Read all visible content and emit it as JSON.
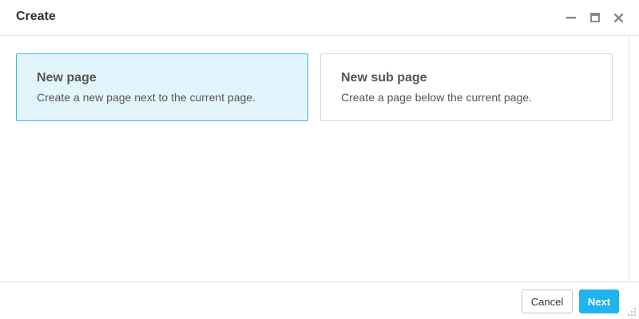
{
  "dialog": {
    "title": "Create",
    "window_controls": {
      "minimize_icon": "minimize-icon",
      "maximize_icon": "maximize-icon",
      "close_icon": "close-icon"
    }
  },
  "options": [
    {
      "title": "New page",
      "description": "Create a new page next to the current page.",
      "selected": true
    },
    {
      "title": "New sub page",
      "description": "Create a page below the current page.",
      "selected": false
    }
  ],
  "footer": {
    "cancel_label": "Cancel",
    "next_label": "Next"
  },
  "colors": {
    "accent": "#1fb3f0",
    "selected_bg": "#e2f5fd",
    "selected_border": "#33b9e5"
  }
}
